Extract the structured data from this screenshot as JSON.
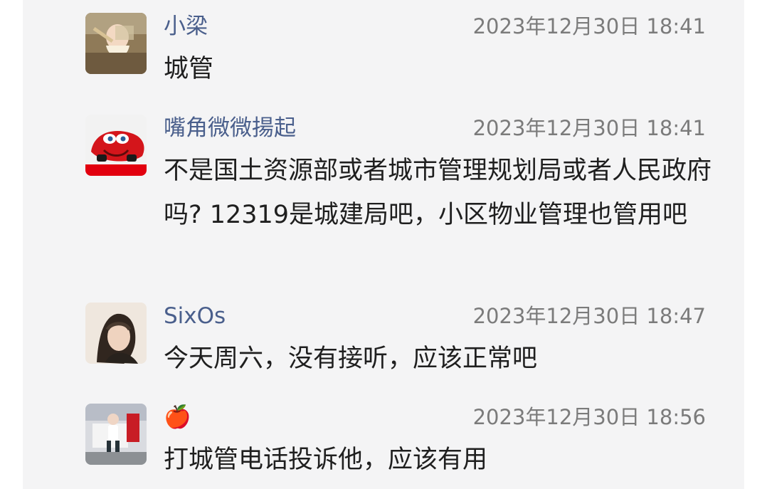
{
  "messages": [
    {
      "name": "小梁",
      "time": "2023年12月30日 18:41",
      "text": "城管"
    },
    {
      "name": "嘴角微微揚起",
      "time": "2023年12月30日 18:41",
      "text": "不是国土资源部或者城市管理规划局或者人民政府吗? 12319是城建局吧，小区物业管理也管用吧"
    },
    {
      "name": "SixOs",
      "time": "2023年12月30日 18:47",
      "text": "今天周六，没有接听，应该正常吧"
    },
    {
      "name": "🍎",
      "time": "2023年12月30日 18:56",
      "text": "打城管电话投诉他，应该有用"
    }
  ],
  "icons": {
    "apple_name": "apple-emoji"
  }
}
